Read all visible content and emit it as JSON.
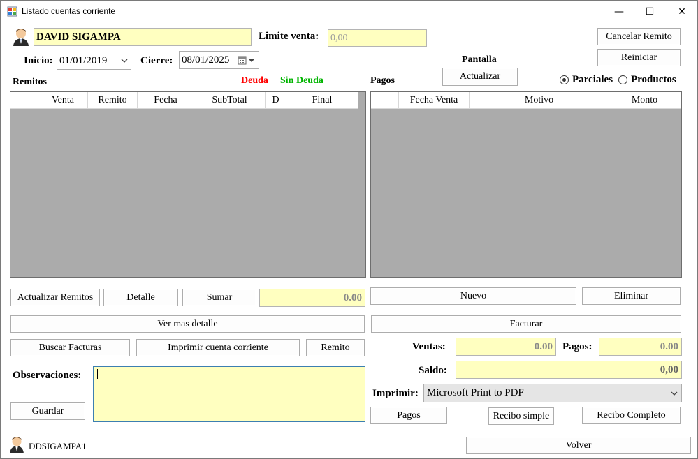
{
  "window": {
    "title": "Listado cuentas corriente",
    "minimize_glyph": "—",
    "maximize_glyph": "☐",
    "close_glyph": "✕"
  },
  "client": {
    "name": "DAVID SIGAMPA",
    "limite_label": "Limite venta:",
    "limite_value": "0,00"
  },
  "dates": {
    "inicio_label": "Inicio:",
    "inicio_value": "01/01/2019",
    "cierre_label": "Cierre:",
    "cierre_value": "08/01/2025"
  },
  "top_buttons": {
    "cancelar": "Cancelar Remito",
    "reiniciar": "Reiniciar",
    "pantalla_label": "Pantalla",
    "actualizar": "Actualizar"
  },
  "remitos": {
    "title": "Remitos",
    "legend_deuda": "Deuda",
    "legend_sin_deuda": "Sin Deuda",
    "columns": [
      "",
      "Venta",
      "Remito",
      "Fecha",
      "SubTotal",
      "D",
      "Final"
    ]
  },
  "pagos_grid": {
    "title": "Pagos",
    "columns": [
      "",
      "Fecha Venta",
      "Motivo",
      "Monto"
    ]
  },
  "view_mode": {
    "parciales": "Parciales",
    "productos": "Productos",
    "selected": "Parciales"
  },
  "remitos_actions": {
    "actualizar": "Actualizar Remitos",
    "detalle": "Detalle",
    "sumar": "Sumar",
    "sum_value": "0.00",
    "ver_mas": "Ver mas detalle",
    "buscar": "Buscar Facturas",
    "imprimir_cc": "Imprimir cuenta corriente",
    "remito": "Remito"
  },
  "pagos_actions": {
    "nuevo": "Nuevo",
    "eliminar": "Eliminar",
    "facturar": "Facturar"
  },
  "totals": {
    "ventas_label": "Ventas:",
    "ventas_value": "0.00",
    "pagos_label": "Pagos:",
    "pagos_value": "0.00",
    "saldo_label": "Saldo:",
    "saldo_value": "0,00"
  },
  "print": {
    "label": "Imprimir:",
    "printer": "Microsoft Print to PDF",
    "pagos": "Pagos",
    "recibo_simple": "Recibo simple",
    "recibo_completo": "Recibo Completo"
  },
  "observaciones": {
    "label": "Observaciones:",
    "value": "",
    "guardar": "Guardar"
  },
  "footer": {
    "user": "DDSIGAMPA1",
    "volver": "Volver"
  },
  "colors": {
    "deuda": "#ff0000",
    "sin_deuda": "#00b400",
    "field_yellow": "#ffffc0",
    "grid_bg": "#ababab"
  }
}
